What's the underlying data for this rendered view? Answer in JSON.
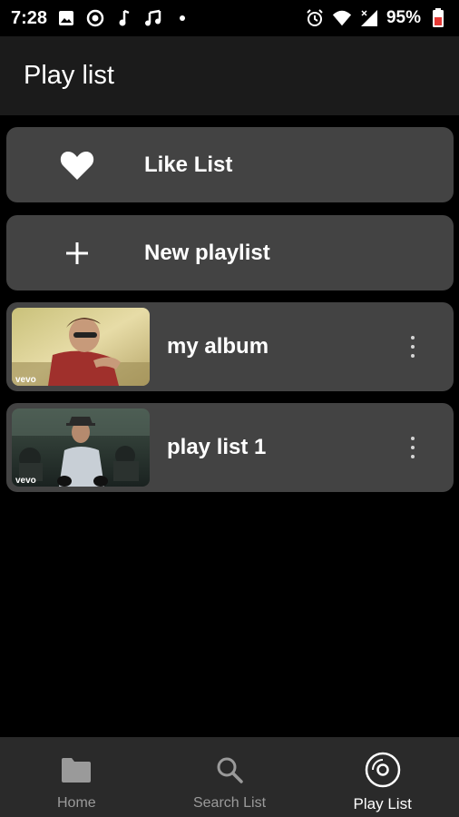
{
  "status_bar": {
    "time": "7:28",
    "battery": "95%",
    "icons": [
      "image-icon",
      "sync-icon",
      "music-note-icon",
      "music-notes-icon",
      "notification-dot-icon",
      "alarm-icon",
      "wifi-icon",
      "signal-icon",
      "battery-icon"
    ]
  },
  "app_bar": {
    "title": "Play list"
  },
  "actions": [
    {
      "label": "Like List",
      "icon": "heart-icon"
    },
    {
      "label": "New playlist",
      "icon": "plus-icon"
    }
  ],
  "playlists": [
    {
      "name": "my album",
      "thumb_badge": "vevo"
    },
    {
      "name": "play list 1",
      "thumb_badge": "vevo"
    }
  ],
  "bottom_nav": {
    "items": [
      {
        "label": "Home",
        "icon": "folder-icon",
        "active": false
      },
      {
        "label": "Search List",
        "icon": "search-icon",
        "active": false
      },
      {
        "label": "Play List",
        "icon": "disc-icon",
        "active": true
      }
    ]
  },
  "colors": {
    "background": "#000000",
    "app_bar": "#1b1b1b",
    "card": "#434343",
    "bottom_nav": "#2a2a2a",
    "inactive_label": "#9a9a9a"
  }
}
